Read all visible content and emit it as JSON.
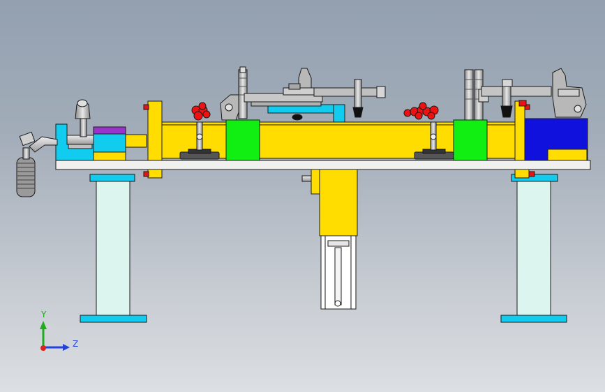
{
  "viewport": {
    "background_top": "#93a0b0",
    "background_bottom": "#dcdfe3"
  },
  "triad": {
    "y_label": "Y",
    "z_label": "Z",
    "y_color": "#22aa22",
    "z_color": "#2244dd",
    "origin_color": "#dd2222"
  },
  "colors": {
    "yellow": "#ffdd00",
    "green": "#11ee11",
    "blue": "#1111dd",
    "cyan": "#11ccee",
    "pale_cyan": "#dcf5ef",
    "plate": "#f0f0ee",
    "steel": "#b8b8b8",
    "red": "#ee1111",
    "purple": "#9933cc",
    "black": "#202020"
  },
  "components": [
    "base-plate",
    "left-support-column",
    "right-support-column",
    "main-yellow-beam",
    "green-locator-block-left",
    "green-locator-block-right",
    "blue-end-block",
    "toggle-clamp-left",
    "toggle-clamp-right",
    "push-pull-clamp",
    "center-cylinder"
  ]
}
